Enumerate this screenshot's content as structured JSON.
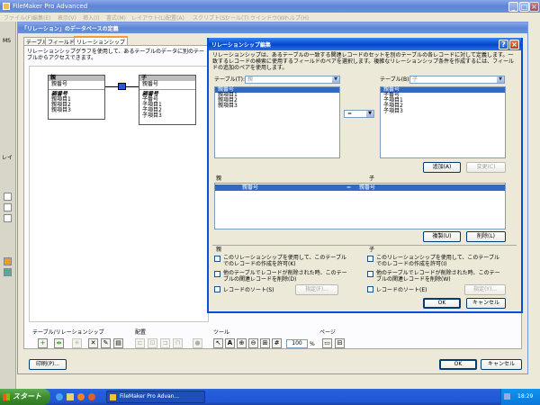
{
  "app": {
    "title": "FileMaker Pro Advanced",
    "menu": [
      "ファイル(F)",
      "編集(E)",
      "表示(V)",
      "挿入(I)",
      "書式(M)",
      "レイアウト(L)",
      "配置(A)",
      "スクリプト(S)",
      "ツール(T)",
      "ウインドウ(W)",
      "ヘルプ(H)"
    ]
  },
  "db_dialog": {
    "title": "「リレーション」のデータベースの定義",
    "tabs": [
      "テーブル",
      "フィールド",
      "リレーションシップ"
    ],
    "description": "リレーションシップグラフを使用して、あるテーブルのデータに別のテーブルからアクセスできます。",
    "parent_table": {
      "name": "親",
      "fields": [
        "親番号",
        "親番号",
        "親項目1",
        "親項目2",
        "親項目3"
      ]
    },
    "child_table": {
      "name": "子",
      "fields": [
        "親番号",
        "親番号",
        "子番号",
        "子項目1",
        "子項目2",
        "子項目3"
      ]
    },
    "toolbar_labels": {
      "table_rel": "テーブル/リレーションシップ",
      "arrange": "配置",
      "tool": "ツール",
      "page": "ページ"
    },
    "zoom": "100",
    "zoom_unit": "%",
    "print_button": "印刷(P)...",
    "ok_button": "OK",
    "cancel_button": "キャンセル"
  },
  "rel_dialog": {
    "title": "リレーションシップ編集",
    "description": "リレーションシップは、あるテーブルの一致する関連レコードのセットを別のテーブルの各レコードに対して定義します。一致するレコードの検索に使用するフィールドのペアを選択します。複雑なリレーションシップ条件を作成するには、フィールドの追加のペアを使用します。",
    "table_left_label": "テーブル(T):",
    "table_left_value": "親",
    "table_right_label": "テーブル(B):",
    "table_right_value": "子",
    "left_fields": [
      "親番号",
      "親項目1",
      "親項目2",
      "親項目3"
    ],
    "right_fields": [
      "親番号",
      "子番号",
      "子項目1",
      "子項目2",
      "子項目3"
    ],
    "operator": "=",
    "add_button": "追加(A)",
    "change_button": "変更(C)",
    "col_parent": "親",
    "col_child": "子",
    "pair": {
      "left": "親番号",
      "op": "=",
      "right": "親番号"
    },
    "duplicate_button": "複製(U)",
    "delete_button": "削除(L)",
    "opt_parent_title": "親",
    "opt_child_title": "子",
    "opt_left": [
      "このリレーションシップを使用して、このテーブルでのレコードの作成を許可(K)",
      "他のテーブルでレコードが削除された時、このテーブルの関連レコードを削除(D)",
      "レコードのソート(S)"
    ],
    "opt_right": [
      "このリレーションシップを使用して、このテーブルでのレコードの作成を許可(I)",
      "他のテーブルでレコードが削除された時、このテーブルの関連レコードを削除(W)",
      "レコードのソート(E)"
    ],
    "sort_button": "指定(F)...",
    "sort_button_right": "指定(Y)...",
    "ok_button": "OK",
    "cancel_button": "キャンセル"
  },
  "taskbar": {
    "start": "スタート",
    "task": "FileMaker Pro Advan...",
    "time": "18:29"
  },
  "left_toolbar": {
    "ms": "MS",
    "ra": "レイ"
  }
}
